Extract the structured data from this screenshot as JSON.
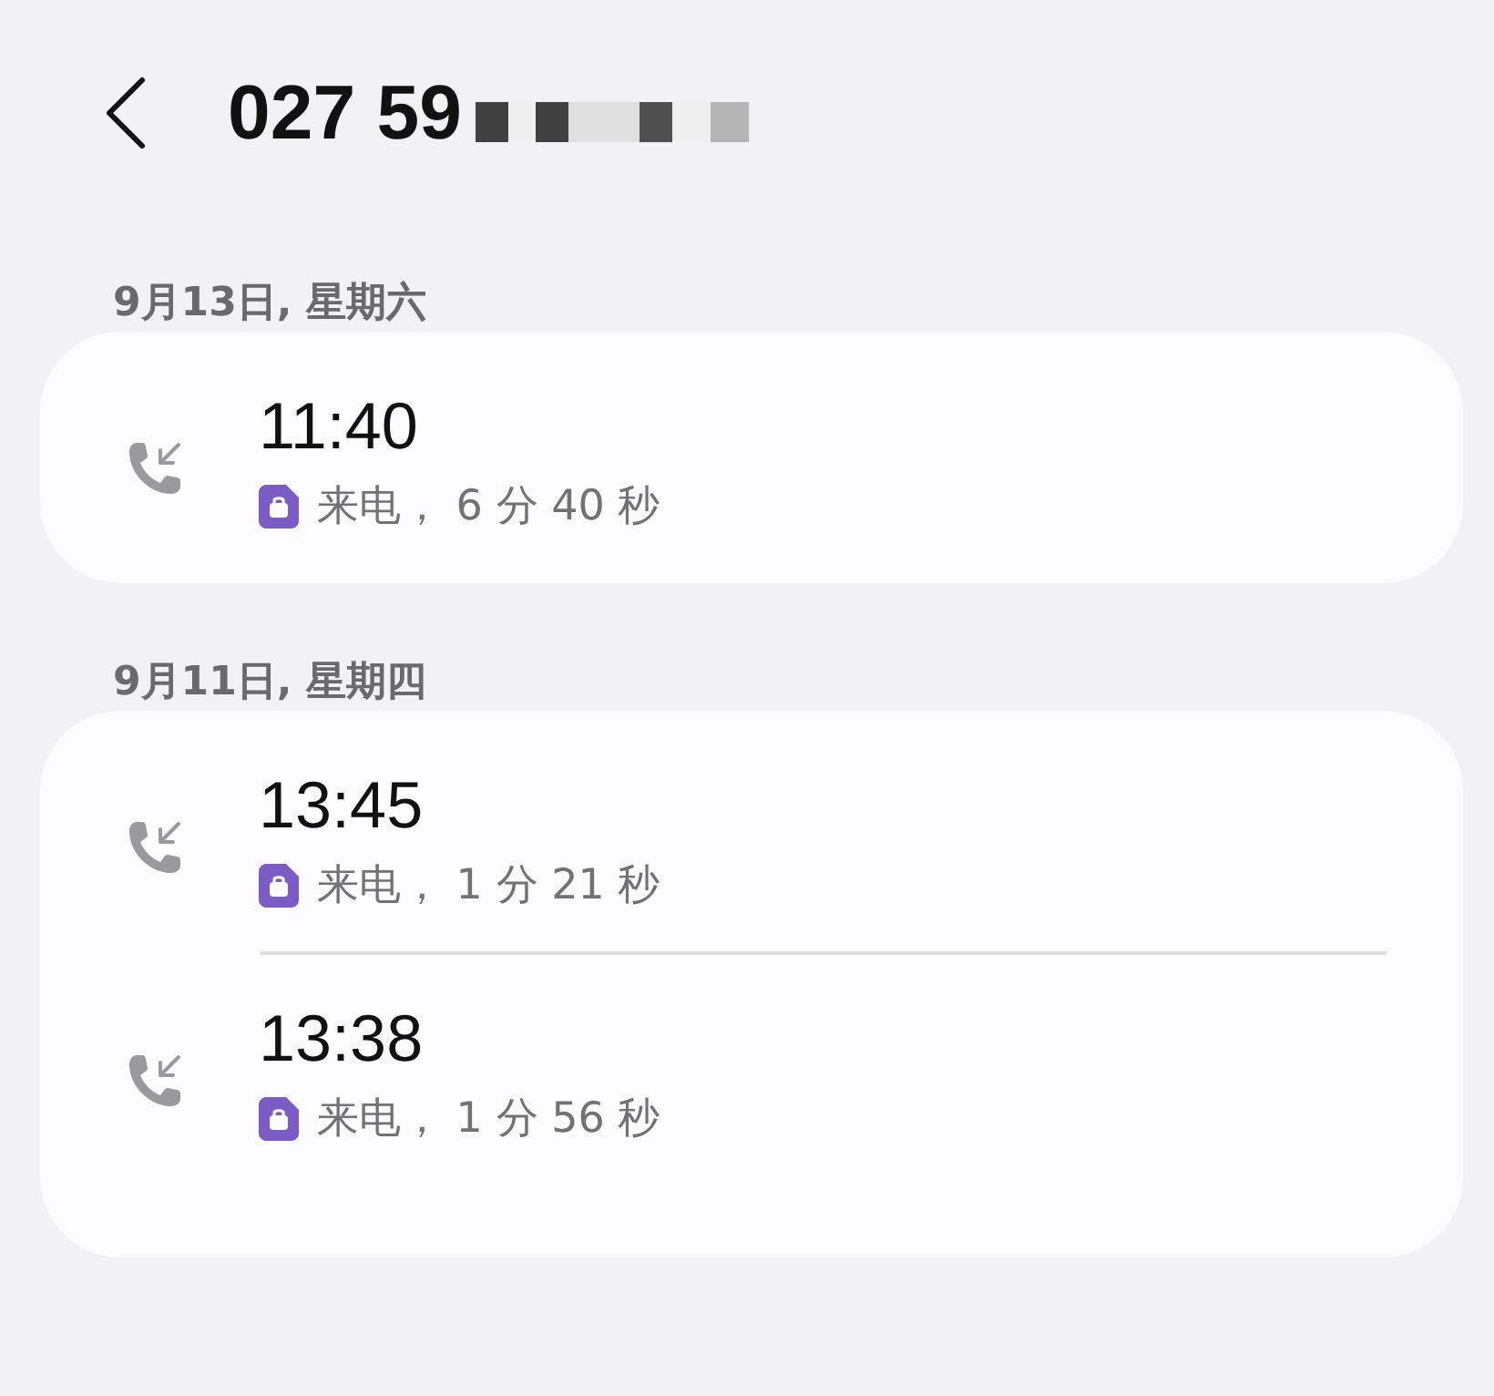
{
  "header": {
    "title": "027 59"
  },
  "groups": [
    {
      "date": "9月13日, 星期六",
      "calls": [
        {
          "time": "11:40",
          "kind": "incoming",
          "detail": "来电， 6 分 40 秒"
        }
      ]
    },
    {
      "date": "9月11日, 星期四",
      "calls": [
        {
          "time": "13:45",
          "kind": "incoming",
          "detail": "来电， 1 分 21 秒"
        },
        {
          "time": "13:38",
          "kind": "incoming",
          "detail": "来电， 1 分 56 秒"
        }
      ]
    }
  ]
}
